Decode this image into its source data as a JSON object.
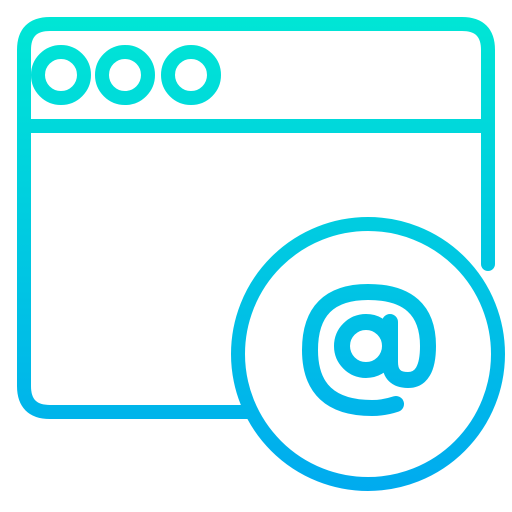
{
  "icon": {
    "name": "browser-email-icon",
    "gradient": {
      "top": "#00E8D4",
      "bottom": "#00A8F0"
    },
    "background": "#FFFFFF"
  }
}
